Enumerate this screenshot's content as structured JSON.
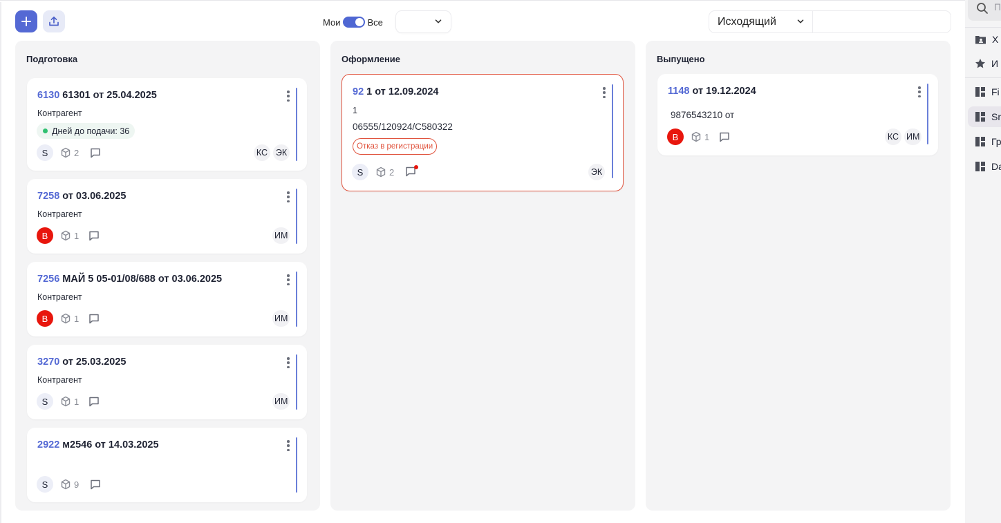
{
  "toolbar": {
    "add_icon": "plus-icon",
    "upload_icon": "upload-icon",
    "filter_mine_label": "Мои",
    "filter_all_label": "Все",
    "filter_all_active": true,
    "status_select_value": "",
    "direction_select_value": "Исходящий",
    "search_value": ""
  },
  "columns": [
    {
      "title": "Подготовка",
      "cards": [
        {
          "num": "6130",
          "title": "61301 от 25.04.2025",
          "line1": "Контрагент",
          "days_label": "Дней до подачи: 36",
          "avatar": "S",
          "avatar_color": "#eceef7",
          "pkg_count": "2",
          "tags": [
            "КС",
            "ЭК"
          ]
        },
        {
          "num": "7258",
          "title": "от 03.06.2025",
          "line1": "Контрагент",
          "avatar": "B",
          "avatar_color": "#e8160d",
          "pkg_count": "1",
          "tags": [
            "ИМ"
          ]
        },
        {
          "num": "7256",
          "title": "МАЙ 5 05-01/08/688 от 03.06.2025",
          "line1": "Контрагент",
          "avatar": "B",
          "avatar_color": "#e8160d",
          "pkg_count": "1",
          "tags": [
            "ИМ"
          ]
        },
        {
          "num": "3270",
          "title": "от 25.03.2025",
          "line1": "Контрагент",
          "avatar": "S",
          "avatar_color": "#eceef7",
          "pkg_count": "1",
          "tags": [
            "ИМ"
          ]
        },
        {
          "num": "2922",
          "title": "м2546 от 14.03.2025",
          "avatar": "S",
          "avatar_color": "#eceef7",
          "pkg_count": "9",
          "tags": []
        }
      ]
    },
    {
      "title": "Оформление",
      "cards": [
        {
          "num": "92",
          "title": "1 от 12.09.2024",
          "line1": "1",
          "line2": "06555/120924/C580322",
          "status_label": "Отказ в регистрации",
          "status_color": "#e0533d",
          "avatar": "S",
          "avatar_color": "#eceef7",
          "pkg_count": "2",
          "has_unread": true,
          "tags": [
            "ЭК"
          ]
        }
      ]
    },
    {
      "title": "Выпущено",
      "cards": [
        {
          "num": "1148",
          "title": "от 19.12.2024",
          "line1": "9876543210 от",
          "avatar": "B",
          "avatar_color": "#e8160d",
          "pkg_count": "1",
          "tags": [
            "КС",
            "ИМ"
          ]
        }
      ]
    }
  ],
  "right_nav": {
    "search_placeholder": "П",
    "items": [
      {
        "icon": "folder-person-icon",
        "label": "Х"
      },
      {
        "icon": "star-icon",
        "label": "И"
      },
      {
        "icon": "dashboard-icon",
        "label": "Fi"
      },
      {
        "icon": "dashboard-icon",
        "label": "Sr",
        "active": true
      },
      {
        "icon": "dashboard-icon",
        "label": "Гр"
      },
      {
        "icon": "dashboard-icon",
        "label": "Da"
      }
    ]
  },
  "colors": {
    "accent": "#5469d4",
    "card_bar": "#6a7fd9",
    "column_bg": "#f4f4f5",
    "error": "#e0533d",
    "success_dot": "#2fc070",
    "avatar_red": "#e8160d"
  }
}
